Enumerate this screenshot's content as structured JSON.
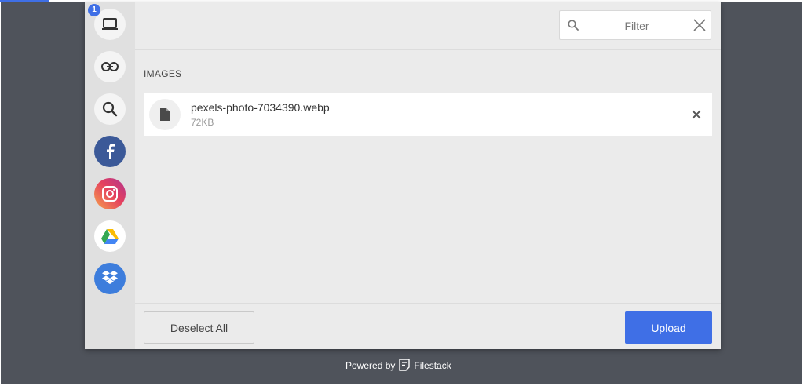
{
  "sources": [
    {
      "name": "my-device",
      "icon": "laptop-icon",
      "badge": "1"
    },
    {
      "name": "link",
      "icon": "link-icon"
    },
    {
      "name": "image-search",
      "icon": "search-icon"
    },
    {
      "name": "facebook",
      "icon": "facebook-icon",
      "color": "#3b5998"
    },
    {
      "name": "instagram",
      "icon": "instagram-icon",
      "color": "#e4405f"
    },
    {
      "name": "google-drive",
      "icon": "google-drive-icon"
    },
    {
      "name": "dropbox",
      "icon": "dropbox-icon",
      "color": "#3d7ddc"
    }
  ],
  "filter": {
    "placeholder": "Filter",
    "value": ""
  },
  "section_title": "IMAGES",
  "files": [
    {
      "name": "pexels-photo-7034390.webp",
      "size": "72KB",
      "icon": "file-icon"
    }
  ],
  "footer": {
    "deselect_label": "Deselect All",
    "upload_label": "Upload"
  },
  "powered_by": {
    "prefix": "Powered by",
    "brand": "Filestack"
  },
  "colors": {
    "accent": "#3f6fe6",
    "backdrop": "#4f535b",
    "panel": "#ebebeb",
    "sidebar": "#e0e0e0"
  }
}
